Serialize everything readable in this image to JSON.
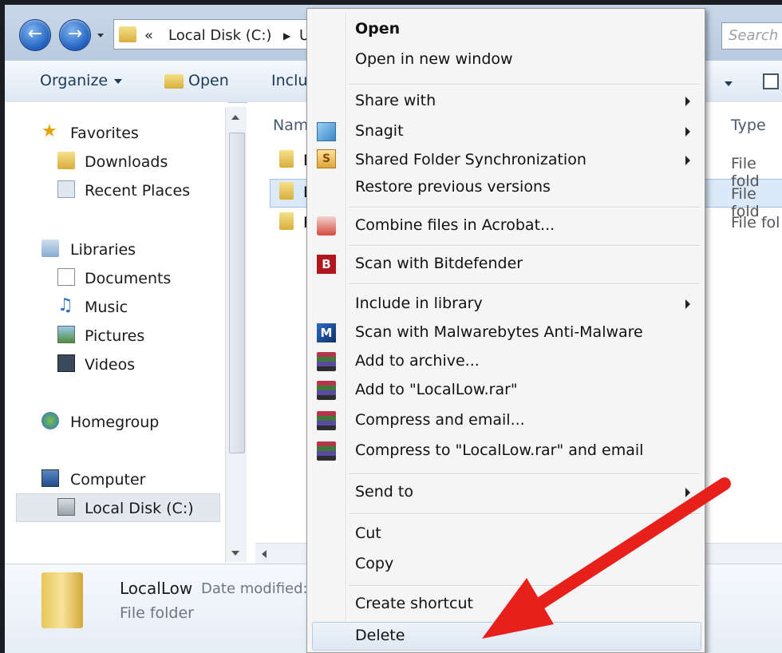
{
  "address": {
    "chevrons": "«",
    "path": [
      "Local Disk (C:)",
      "U"
    ]
  },
  "search": {
    "placeholder": "Search"
  },
  "toolbar": {
    "organize": "Organize",
    "open": "Open",
    "include": "Inclu"
  },
  "sidebar": {
    "favorites": "Favorites",
    "downloads": "Downloads",
    "recent": "Recent Places",
    "libraries": "Libraries",
    "documents": "Documents",
    "music": "Music",
    "pictures": "Pictures",
    "videos": "Videos",
    "homegroup": "Homegroup",
    "computer": "Computer",
    "localdisk": "Local Disk (C:)"
  },
  "content": {
    "col_name": "Nam",
    "col_type": "Type",
    "rows": [
      {
        "name": "L",
        "type": "File fold"
      },
      {
        "name": "L",
        "type": "File fold"
      },
      {
        "name": "R",
        "type": "File fol"
      }
    ]
  },
  "details": {
    "name": "LocalLow",
    "date_label": "Date modified:",
    "kind": "File folder"
  },
  "context_menu": {
    "open": "Open",
    "open_new": "Open in new window",
    "share": "Share with",
    "snagit": "Snagit",
    "sync": "Shared Folder Synchronization",
    "restore": "Restore previous versions",
    "acrobat": "Combine files in Acrobat...",
    "bitdefender": "Scan with Bitdefender",
    "include": "Include in library",
    "malwarebytes": "Scan with Malwarebytes Anti-Malware",
    "archive": "Add to archive...",
    "add_rar": "Add to \"LocalLow.rar\"",
    "compress_email": "Compress and email...",
    "compress_rar_email": "Compress to \"LocalLow.rar\" and email",
    "send_to": "Send to",
    "cut": "Cut",
    "copy": "Copy",
    "shortcut": "Create shortcut",
    "delete": "Delete"
  },
  "colors": {
    "highlight_arrow": "#e8201c",
    "accent": "#1f5fbf"
  }
}
